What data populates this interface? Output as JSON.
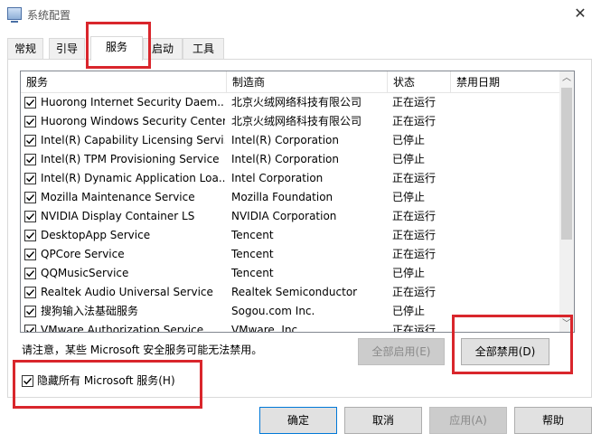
{
  "window": {
    "title": "系统配置",
    "close_glyph": "✕"
  },
  "tabs": [
    {
      "label": "常规"
    },
    {
      "label": "引导"
    },
    {
      "label": "服务"
    },
    {
      "label": "启动"
    },
    {
      "label": "工具"
    }
  ],
  "active_tab": "服务",
  "columns": [
    "服务",
    "制造商",
    "状态",
    "禁用日期"
  ],
  "services": [
    {
      "name": "Huorong Internet Security Daem...",
      "maker": "北京火绒网络科技有限公司",
      "status": "正在运行",
      "checked": true
    },
    {
      "name": "Huorong Windows Security Center",
      "maker": "北京火绒网络科技有限公司",
      "status": "正在运行",
      "checked": true
    },
    {
      "name": "Intel(R) Capability Licensing Servi...",
      "maker": "Intel(R) Corporation",
      "status": "已停止",
      "checked": true
    },
    {
      "name": "Intel(R) TPM Provisioning Service",
      "maker": "Intel(R) Corporation",
      "status": "已停止",
      "checked": true
    },
    {
      "name": "Intel(R) Dynamic Application Loa...",
      "maker": "Intel Corporation",
      "status": "正在运行",
      "checked": true
    },
    {
      "name": "Mozilla Maintenance Service",
      "maker": "Mozilla Foundation",
      "status": "已停止",
      "checked": true
    },
    {
      "name": "NVIDIA Display Container LS",
      "maker": "NVIDIA Corporation",
      "status": "正在运行",
      "checked": true
    },
    {
      "name": "DesktopApp Service",
      "maker": "Tencent",
      "status": "正在运行",
      "checked": true
    },
    {
      "name": "QPCore Service",
      "maker": "Tencent",
      "status": "正在运行",
      "checked": true
    },
    {
      "name": "QQMusicService",
      "maker": "Tencent",
      "status": "已停止",
      "checked": true
    },
    {
      "name": "Realtek Audio Universal Service",
      "maker": "Realtek Semiconductor",
      "status": "正在运行",
      "checked": true
    },
    {
      "name": "搜狗输入法基础服务",
      "maker": "Sogou.com Inc.",
      "status": "已停止",
      "checked": true
    },
    {
      "name": "VMware Authorization Service",
      "maker": "VMware, Inc.",
      "status": "正在运行",
      "checked": true
    }
  ],
  "scroll": {
    "up_glyph": "︿",
    "down_glyph": "﹀"
  },
  "notice": "请注意，某些 Microsoft 安全服务可能无法禁用。",
  "buttons": {
    "enable_all": "全部启用(E)",
    "disable_all": "全部禁用(D)",
    "ok": "确定",
    "cancel": "取消",
    "apply": "应用(A)",
    "help": "帮助"
  },
  "hide_ms": {
    "label": "隐藏所有 Microsoft 服务(H)",
    "checked": true
  },
  "colors": {
    "highlight": "#d9262c",
    "accent": "#0078d7"
  }
}
